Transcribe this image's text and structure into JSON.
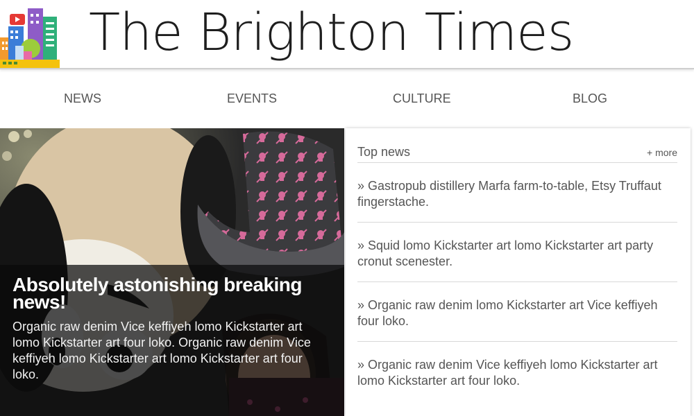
{
  "site": {
    "title": "The Brighton Times"
  },
  "nav": {
    "items": [
      {
        "label": "NEWS"
      },
      {
        "label": "EVENTS"
      },
      {
        "label": "CULTURE"
      },
      {
        "label": "BLOG"
      }
    ]
  },
  "hero": {
    "title": "Absolutely astonishing breaking news!",
    "text": "Organic raw denim Vice keffiyeh lomo Kickstarter art lomo Kickstarter art four loko. Organic raw denim Vice keffiyeh lomo Kickstarter art lomo Kickstarter art four loko."
  },
  "top_news": {
    "title": "Top news",
    "more_label": "+ more",
    "items": [
      {
        "text": "» Gastropub distillery Marfa farm-to-table, Etsy Truffaut fingerstache."
      },
      {
        "text": "» Squid lomo Kickstarter art lomo Kickstarter art party cronut scenester."
      },
      {
        "text": "» Organic raw denim lomo Kickstarter art Vice keffiyeh four loko."
      },
      {
        "text": "» Organic raw denim Vice keffiyeh lomo Kickstarter art lomo Kickstarter art four loko."
      }
    ]
  },
  "colors": {
    "title_text": "#1e1e1e",
    "nav_text": "#555555",
    "hero_overlay": "#0a0a0a",
    "divider": "#d8d8d8"
  }
}
